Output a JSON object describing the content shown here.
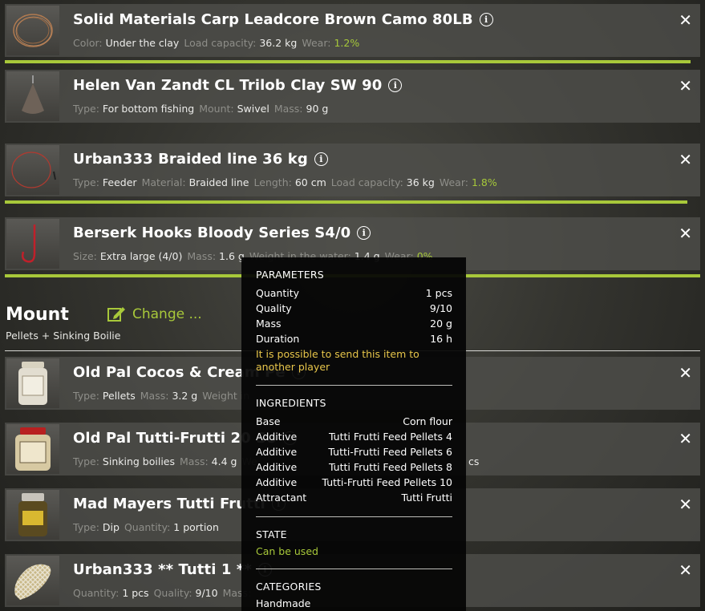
{
  "items": [
    {
      "title": "Solid Materials Carp Leadcore Brown Camo 80LB",
      "props": [
        {
          "label": "Color:",
          "value": "Under the clay"
        },
        {
          "label": "Load capacity:",
          "value": "36.2 kg"
        },
        {
          "label": "Wear:",
          "value": "1.2%",
          "kind": "wear"
        }
      ],
      "icon": "coiled-line-icon"
    },
    {
      "title": "Helen Van Zandt CL Trilob Clay SW 90",
      "props": [
        {
          "label": "Type:",
          "value": "For bottom fishing"
        },
        {
          "label": "Mount:",
          "value": "Swivel"
        },
        {
          "label": "Mass:",
          "value": "90 g"
        }
      ],
      "icon": "sinker-icon"
    },
    {
      "title": "Urban333 Braided line 36 kg",
      "props": [
        {
          "label": "Type:",
          "value": "Feeder"
        },
        {
          "label": "Material:",
          "value": "Braided line"
        },
        {
          "label": "Length:",
          "value": "60 cm"
        },
        {
          "label": "Load capacity:",
          "value": "36 kg"
        },
        {
          "label": "Wear:",
          "value": "1.8%",
          "kind": "wear"
        }
      ],
      "icon": "braided-line-icon"
    },
    {
      "title": "Berserk Hooks Bloody Series S4/0",
      "props": [
        {
          "label": "Size:",
          "value": "Extra large (4/0)"
        },
        {
          "label": "Mass:",
          "value": "1.6 g"
        },
        {
          "label": "Weight in the water:",
          "value": "1.4 g"
        },
        {
          "label": "Wear:",
          "value": "0%",
          "kind": "wear"
        }
      ],
      "icon": "hook-icon"
    },
    {
      "title": "Old Pal Cocos & Cream Pe",
      "props": [
        {
          "label": "Type:",
          "value": "Pellets"
        },
        {
          "label": "Mass:",
          "value": "3.2 g"
        },
        {
          "label": "Weight in",
          "value": ""
        }
      ],
      "icon": "jar-icon"
    },
    {
      "title": "Old Pal Tutti-Frutti 20 So",
      "props": [
        {
          "label": "Type:",
          "value": "Sinking boilies"
        },
        {
          "label": "Mass:",
          "value": "4.4 g"
        },
        {
          "label": "We",
          "value": ""
        }
      ],
      "icon": "jar-red-lid-icon",
      "trailing": "cs"
    },
    {
      "title": "Mad Mayers Tutti Frutti",
      "props": [
        {
          "label": "Type:",
          "value": "Dip"
        },
        {
          "label": "Quantity:",
          "value": "1 portion"
        }
      ],
      "icon": "dip-jar-icon"
    },
    {
      "title": "Urban333 ** Tutti 1 **",
      "props": [
        {
          "label": "Quantity:",
          "value": "1 pcs"
        },
        {
          "label": "Quality:",
          "value": "9/10"
        },
        {
          "label": "Mass:",
          "value": ""
        }
      ],
      "icon": "mesh-bag-icon"
    }
  ],
  "mount": {
    "title": "Mount",
    "subtitle": "Pellets + Sinking Boilie",
    "change_label": "Change ..."
  },
  "tooltip": {
    "parameters_header": "PARAMETERS",
    "parameters": [
      {
        "label": "Quantity",
        "value": "1 pcs"
      },
      {
        "label": "Quality",
        "value": "9/10"
      },
      {
        "label": "Mass",
        "value": "20 g"
      },
      {
        "label": "Duration",
        "value": "16 h"
      }
    ],
    "note": "It is possible to send this item to another player",
    "ingredients_header": "INGREDIENTS",
    "ingredients": [
      {
        "label": "Base",
        "value": "Corn flour"
      },
      {
        "label": "Additive",
        "value": "Tutti Frutti Feed Pellets 4"
      },
      {
        "label": "Additive",
        "value": "Tutti-Frutti Feed Pellets 6"
      },
      {
        "label": "Additive",
        "value": "Tutti Frutti Feed Pellets 8"
      },
      {
        "label": "Additive",
        "value": "Tutti-Frutti Feed Pellets 10"
      },
      {
        "label": "Attractant",
        "value": "Tutti Frutti"
      }
    ],
    "state_header": "STATE",
    "state_value": "Can be used",
    "categories_header": "CATEGORIES",
    "categories_value": "Handmade"
  },
  "colors": {
    "accent": "#a8c83a",
    "note": "#e8c64b"
  }
}
